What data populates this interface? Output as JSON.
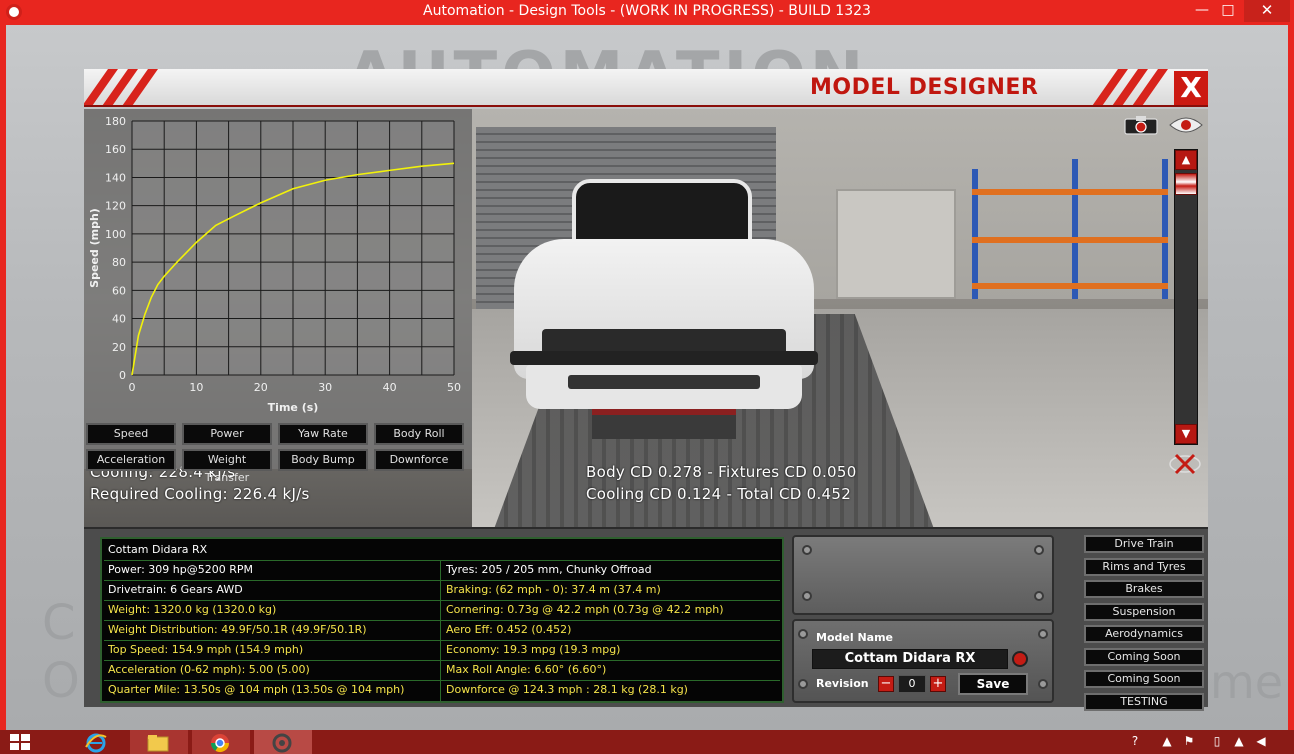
{
  "window": {
    "title": "Automation - Design Tools - (WORK IN PROGRESS) - BUILD 1323",
    "minimize_glyph": "—",
    "maximize_glyph": "□",
    "close_glyph": "✕"
  },
  "background": {
    "logo_text": "AUTOMATION",
    "left_c": "C",
    "left_o": "O",
    "right_me": "me"
  },
  "header": {
    "title": "MODEL DESIGNER",
    "close_label": "X"
  },
  "graph": {
    "buttons_row1": [
      "Speed",
      "Power",
      "Yaw Rate",
      "Body Roll"
    ],
    "buttons_row2": [
      "Acceleration",
      "Weight Transfer",
      "Body Bump",
      "Downforce"
    ]
  },
  "chart_data": {
    "type": "line",
    "xlabel": "Time (s)",
    "ylabel": "Speed (mph)",
    "xlim": [
      0,
      50
    ],
    "ylim": [
      0,
      180
    ],
    "x_ticks": [
      0,
      10,
      20,
      30,
      40,
      50
    ],
    "y_ticks": [
      0,
      20,
      40,
      60,
      80,
      100,
      120,
      140,
      160,
      180
    ],
    "grid": true,
    "series": [
      {
        "color": "#f2f20a",
        "x": [
          0,
          1,
          2,
          3,
          4,
          5,
          7,
          10,
          13,
          16,
          20,
          25,
          30,
          35,
          40,
          45,
          50
        ],
        "y": [
          0,
          28,
          43,
          55,
          64,
          70,
          80,
          94,
          106,
          113,
          122,
          132,
          138,
          142,
          145,
          148,
          150
        ]
      }
    ]
  },
  "stats_overlay": {
    "cooling": "Cooling: 228.4 kJ/s",
    "required_cooling": "Required Cooling: 226.4 kJ/s",
    "body_cd": "Body CD 0.278 - Fixtures CD 0.050",
    "cooling_cd": "Cooling CD 0.124 - Total CD 0.452"
  },
  "stats": {
    "title": "Cottam Didara RX",
    "rows": [
      {
        "left": "Power: 309 hp@5200 RPM",
        "right": "Tyres: 205 / 205 mm, Chunky Offroad"
      },
      {
        "left": "Drivetrain: 6 Gears AWD",
        "right": "Braking: (62 mph - 0): 37.4 m (37.4 m)"
      },
      {
        "left": "Weight: 1320.0 kg (1320.0 kg)",
        "right": "Cornering: 0.73g @ 42.2 mph (0.73g @ 42.2 mph)"
      },
      {
        "left": "Weight Distribution: 49.9F/50.1R (49.9F/50.1R)",
        "right": "Aero Eff: 0.452 (0.452)"
      },
      {
        "left": "Top Speed: 154.9 mph (154.9 mph)",
        "right": "Economy: 19.3 mpg (19.3 mpg)"
      },
      {
        "left": "Acceleration (0-62 mph): 5.00 (5.00)",
        "right": "Max Roll Angle: 6.60° (6.60°)"
      },
      {
        "left": "Quarter Mile: 13.50s @ 104 mph (13.50s @ 104 mph)",
        "right": "Downforce @ 124.3 mph : 28.1 kg (28.1 kg)"
      }
    ]
  },
  "model": {
    "name_label": "Model Name",
    "name_value": "Cottam Didara  RX",
    "revision_label": "Revision",
    "revision_value": "0",
    "minus": "−",
    "plus": "+",
    "save_label": "Save"
  },
  "side_tabs": [
    "Drive Train",
    "Rims and Tyres",
    "Brakes",
    "Suspension",
    "Aerodynamics",
    "Coming Soon",
    "Coming Soon",
    "TESTING"
  ],
  "viewport_controls": {
    "scroll_up": "▲",
    "scroll_down": "▼"
  },
  "colors": {
    "accent_red": "#d8241c",
    "stat_yellow": "#f4e34a",
    "grid_green": "#2a6a2a",
    "taskbar": "#8a1b16"
  }
}
